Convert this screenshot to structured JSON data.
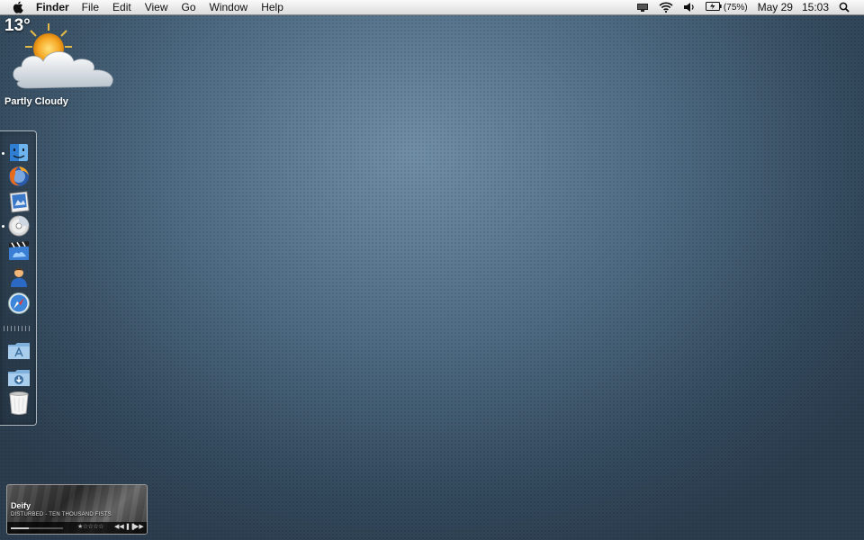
{
  "menubar": {
    "app_name": "Finder",
    "menus": [
      "File",
      "Edit",
      "View",
      "Go",
      "Window",
      "Help"
    ],
    "battery_percent": "(75%)",
    "date": "May 29",
    "time": "15:03"
  },
  "weather": {
    "temperature": "13°",
    "condition": "Partly Cloudy"
  },
  "dock": {
    "items": [
      {
        "icon": "finder-icon",
        "running": true
      },
      {
        "icon": "firefox-icon",
        "running": false
      },
      {
        "icon": "preview-icon",
        "running": false
      },
      {
        "icon": "dvd-player-icon",
        "running": true
      },
      {
        "icon": "imovie-icon",
        "running": false
      },
      {
        "icon": "contacts-icon",
        "running": false
      },
      {
        "icon": "safari-icon",
        "running": false
      },
      {
        "icon": "applications-folder-icon",
        "running": false
      },
      {
        "icon": "downloads-folder-icon",
        "running": false
      },
      {
        "icon": "trash-icon",
        "running": false
      }
    ]
  },
  "music": {
    "song_title": "Deify",
    "artist_album": "DISTURBED - TEN THOUSAND FISTS",
    "rating": "★☆☆☆☆",
    "progress": 0.35,
    "controls": {
      "prev": "◀◀",
      "pause": "❚❚",
      "next": "▶▶"
    }
  }
}
